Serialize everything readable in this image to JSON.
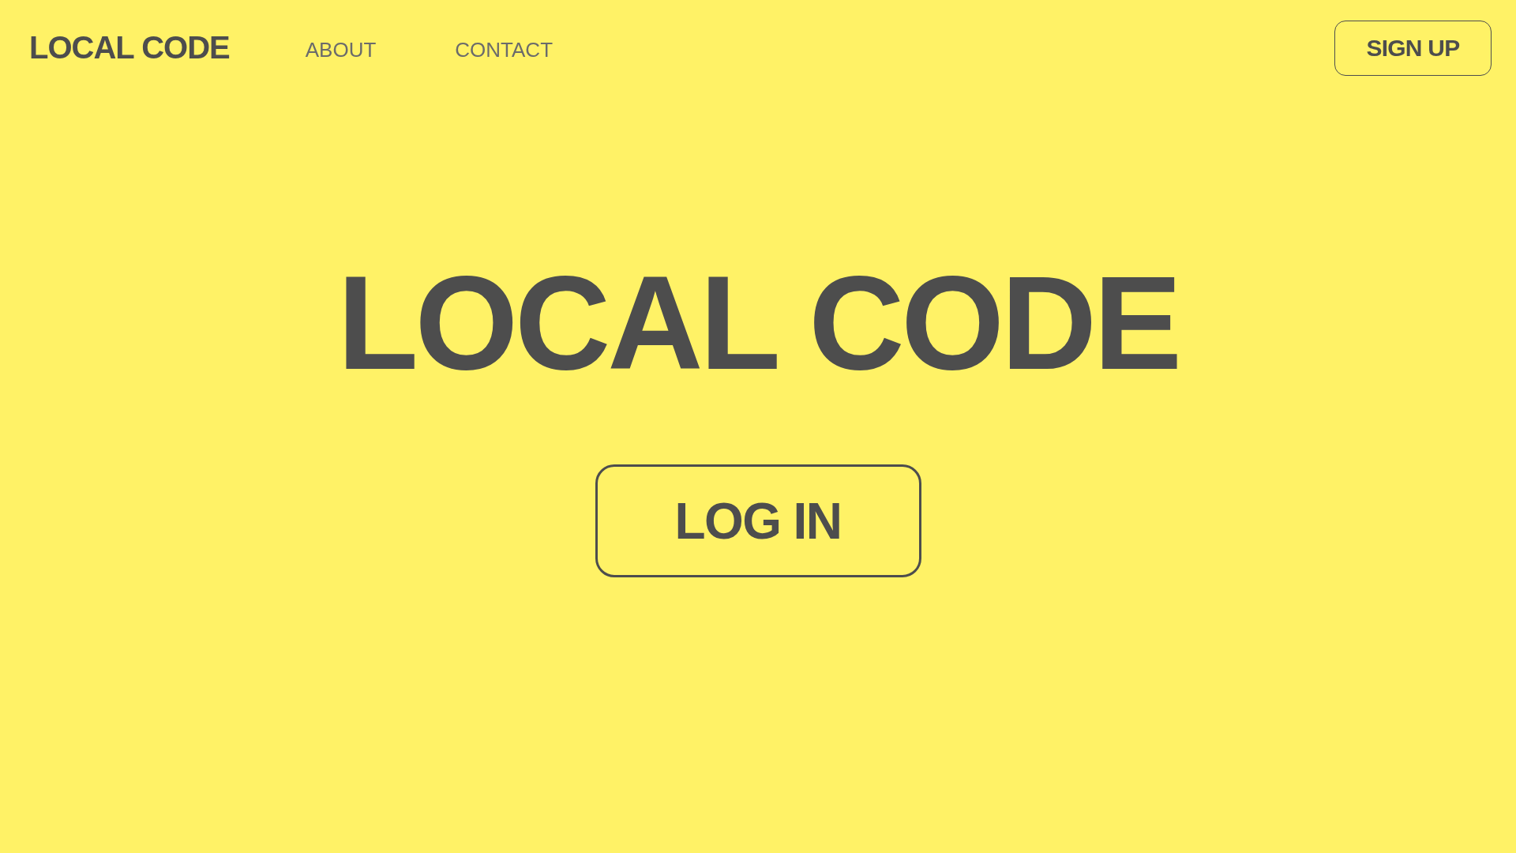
{
  "header": {
    "logo": "LOCAL CODE",
    "nav": [
      {
        "label": "ABOUT"
      },
      {
        "label": "CONTACT"
      }
    ],
    "signup": "SIGN UP"
  },
  "hero": {
    "title": "LOCAL CODE",
    "login": "LOG IN"
  }
}
